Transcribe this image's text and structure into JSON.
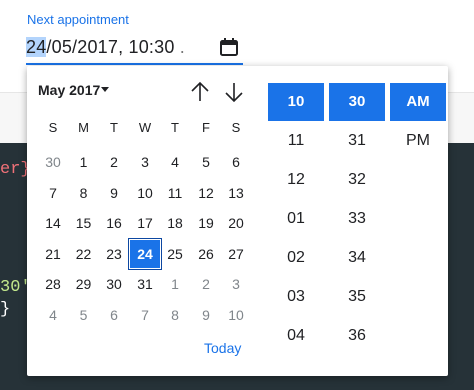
{
  "field": {
    "label": "Next appointment",
    "value_day": "24",
    "value_rest": "/05/2017, 10:30",
    "value_tail": " ."
  },
  "background": {
    "code_line_1": "er}",
    "code_line_2": "30'",
    "code_line_3": " }"
  },
  "calendar": {
    "month_label": "May 2017",
    "weekdays": [
      "S",
      "M",
      "T",
      "W",
      "T",
      "F",
      "S"
    ],
    "weeks": [
      [
        {
          "d": "30",
          "o": true
        },
        {
          "d": "1"
        },
        {
          "d": "2"
        },
        {
          "d": "3"
        },
        {
          "d": "4"
        },
        {
          "d": "5"
        },
        {
          "d": "6"
        }
      ],
      [
        {
          "d": "7"
        },
        {
          "d": "8"
        },
        {
          "d": "9"
        },
        {
          "d": "10"
        },
        {
          "d": "11"
        },
        {
          "d": "12"
        },
        {
          "d": "13"
        }
      ],
      [
        {
          "d": "14"
        },
        {
          "d": "15"
        },
        {
          "d": "16"
        },
        {
          "d": "17"
        },
        {
          "d": "18"
        },
        {
          "d": "19"
        },
        {
          "d": "20"
        }
      ],
      [
        {
          "d": "21"
        },
        {
          "d": "22"
        },
        {
          "d": "23"
        },
        {
          "d": "24",
          "s": true
        },
        {
          "d": "25"
        },
        {
          "d": "26"
        },
        {
          "d": "27"
        }
      ],
      [
        {
          "d": "28"
        },
        {
          "d": "29"
        },
        {
          "d": "30"
        },
        {
          "d": "31"
        },
        {
          "d": "1",
          "o": true
        },
        {
          "d": "2",
          "o": true
        },
        {
          "d": "3",
          "o": true
        }
      ],
      [
        {
          "d": "4",
          "o": true
        },
        {
          "d": "5",
          "o": true
        },
        {
          "d": "6",
          "o": true
        },
        {
          "d": "7",
          "o": true
        },
        {
          "d": "8",
          "o": true
        },
        {
          "d": "9",
          "o": true
        },
        {
          "d": "10",
          "o": true
        }
      ]
    ],
    "today_label": "Today"
  },
  "time": {
    "hours": [
      "10",
      "11",
      "12",
      "01",
      "02",
      "03",
      "04"
    ],
    "minutes": [
      "30",
      "31",
      "32",
      "33",
      "34",
      "35",
      "36"
    ],
    "ampm": [
      "AM",
      "PM"
    ]
  },
  "colors": {
    "accent": "#1a73e8",
    "code_bg": "#263238"
  },
  "icons": {
    "field_icon": "calendar-icon",
    "nav_prev": "arrow-up-icon",
    "nav_next": "arrow-down-icon"
  }
}
